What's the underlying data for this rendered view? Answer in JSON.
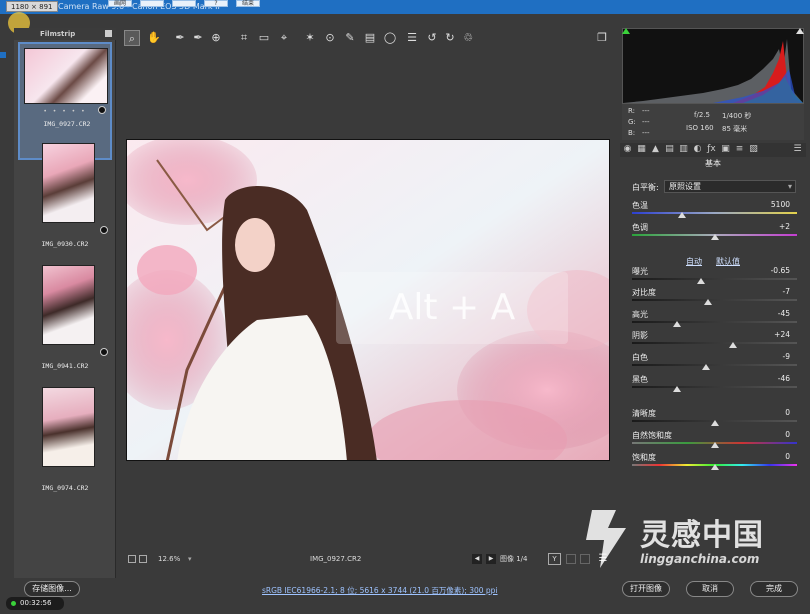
{
  "window": {
    "size_badge": "1180 × 891",
    "title": "Camera Raw 9.6 - Canon EOS 5D Mark II",
    "tb_buttons": [
      "画网",
      "",
      "",
      "?",
      "结束"
    ]
  },
  "filmstrip": {
    "header": "Filmstrip",
    "items": [
      {
        "name": "IMG_0927.CR2",
        "selected": true
      },
      {
        "name": "IMG_0930.CR2",
        "selected": false
      },
      {
        "name": "IMG_0941.CR2",
        "selected": false
      },
      {
        "name": "IMG_0974.CR2",
        "selected": false
      }
    ],
    "stars": "• • • • •"
  },
  "toolbar": {
    "tools": [
      "zoom-icon",
      "hand-icon",
      "white-balance-icon",
      "color-sampler-icon",
      "target-adjust-icon",
      "crop-icon",
      "straighten-icon",
      "transform-icon",
      "spot-removal-icon",
      "red-eye-icon",
      "adjustment-brush-icon",
      "graduated-filter-icon",
      "radial-filter-icon",
      "preferences-icon",
      "rotate-left-icon",
      "rotate-right-icon",
      "trash-icon",
      "fullscreen-icon"
    ]
  },
  "preview": {
    "overlay_key": "Alt + A"
  },
  "bottombar": {
    "zoom": "12.6%",
    "filename": "IMG_0927.CR2",
    "image_counter": "图像 1/4",
    "y_label": "Y"
  },
  "info": {
    "r_label": "R:",
    "g_label": "G:",
    "b_label": "B:",
    "r": "---",
    "g": "---",
    "b": "---",
    "aperture": "f/2.5",
    "shutter": "1/400 秒",
    "iso": "ISO 160",
    "focal": "85 毫米"
  },
  "basic": {
    "panel_title": "基本",
    "white_balance_label": "白平衡:",
    "white_balance_value": "原照设置",
    "auto": "自动",
    "default": "默认值",
    "sliders": [
      {
        "label": "色温",
        "value": "5100",
        "pos": 0.3,
        "track": "temp"
      },
      {
        "label": "色调",
        "value": "+2",
        "pos": 0.5,
        "track": "tint"
      },
      {
        "label": "曝光",
        "value": "-0.65",
        "pos": 0.42,
        "track": "gray"
      },
      {
        "label": "对比度",
        "value": "-7",
        "pos": 0.46,
        "track": "gray"
      },
      {
        "label": "高光",
        "value": "-45",
        "pos": 0.27,
        "track": "gray"
      },
      {
        "label": "阴影",
        "value": "+24",
        "pos": 0.61,
        "track": "gray"
      },
      {
        "label": "白色",
        "value": "-9",
        "pos": 0.45,
        "track": "gray"
      },
      {
        "label": "黑色",
        "value": "-46",
        "pos": 0.27,
        "track": "gray"
      },
      {
        "label": "清晰度",
        "value": "0",
        "pos": 0.5,
        "track": "gray"
      },
      {
        "label": "自然饱和度",
        "value": "0",
        "pos": 0.5,
        "track": "vib"
      },
      {
        "label": "饱和度",
        "value": "0",
        "pos": 0.5,
        "track": "sat"
      }
    ]
  },
  "footer": {
    "save_label": "存储图像...",
    "workflow_link": "sRGB IEC61966-2.1; 8 位; 5616 x 3744 (21.0 百万像素); 300 ppi",
    "open_label": "打开图像",
    "cancel_label": "取消",
    "done_label": "完成",
    "timer": "00:32:56"
  },
  "watermark": {
    "text": "灵感中国",
    "sub": "lingganchina.com"
  },
  "colors": {
    "title_blue": "#1f6fc2",
    "selected_thumb": "#5e8cc8",
    "link": "#9ec3ff"
  }
}
